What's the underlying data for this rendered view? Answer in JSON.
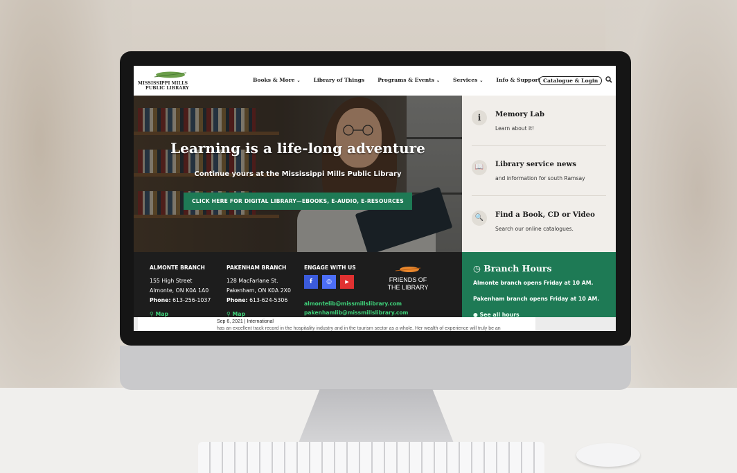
{
  "site": {
    "logo_line1": "MISSISSIPPI MILLS",
    "logo_line2": "PUBLIC LIBRARY"
  },
  "nav": {
    "items": [
      {
        "label": "Books & More",
        "has_dropdown": true
      },
      {
        "label": "Library of Things",
        "has_dropdown": false
      },
      {
        "label": "Programs & Events",
        "has_dropdown": true
      },
      {
        "label": "Services",
        "has_dropdown": true
      },
      {
        "label": "Info & Support",
        "has_dropdown": true
      }
    ],
    "catalogue_button": "Catalogue & Login",
    "chevron": "⌄",
    "search_icon": "search-icon"
  },
  "hero": {
    "title": "Learning is a life-long adventure",
    "subtitle": "Continue yours at the Mississippi Mills Public Library",
    "cta": "CLICK HERE FOR DIGITAL LIBRARY—EBOOKS, E-AUDIO, E-RESOURCES",
    "cta_color": "#1e7a55"
  },
  "cards": [
    {
      "icon": "i",
      "icon_name": "info-icon",
      "title": "Memory Lab",
      "subtitle": "Learn about it!"
    },
    {
      "icon": "📖",
      "icon_name": "open-book-icon",
      "title": "Library service news",
      "subtitle": "and information for south Ramsay"
    },
    {
      "icon": "🔍",
      "icon_name": "zoom-in-icon",
      "title": "Find a Book, CD or Video",
      "subtitle": "Search our online catalogues."
    }
  ],
  "footer": {
    "almonte": {
      "heading": "ALMONTE BRANCH",
      "address1": "155 High Street",
      "address2": "Almonte, ON K0A 1A0",
      "phone_label": "Phone:",
      "phone": "613-256-1037",
      "map": "Map"
    },
    "pakenham": {
      "heading": "PAKENHAM BRANCH",
      "address1": "128 MacFarlane St.",
      "address2": "Pakenham, ON K0A 2X0",
      "phone_label": "Phone:",
      "phone": "613-624-5306",
      "map": "Map"
    },
    "engage": {
      "heading": "ENGAGE WITH US",
      "social": [
        {
          "glyph": "f",
          "name": "facebook-icon",
          "color": "#3b5bdb"
        },
        {
          "glyph": "◎",
          "name": "instagram-icon",
          "color": "#4c6ef5"
        },
        {
          "glyph": "▶",
          "name": "youtube-icon",
          "color": "#e03131"
        }
      ],
      "email1": "almontelib@missmillslibrary.com",
      "email2": "pakenhamlib@missmillslibrary.com"
    },
    "friends": {
      "line1": "FRIENDS OF",
      "line2": "THE LIBRARY"
    },
    "map_pin": "⚲",
    "link_color": "#3fd27a"
  },
  "hours": {
    "title": "Branch Hours",
    "clock": "◷",
    "line1": "Almonte branch opens Friday at 10 AM.",
    "line2": "Pakenham branch opens Friday at 10 AM.",
    "see_all": "See all hours",
    "bg_color": "#1e7a55"
  },
  "strip": {
    "date": "Sep 6, 2021 | International",
    "snippet": "has an excellent track record in the hospitality industry and in the tourism sector as a whole. Her wealth of experience will truly be an"
  }
}
